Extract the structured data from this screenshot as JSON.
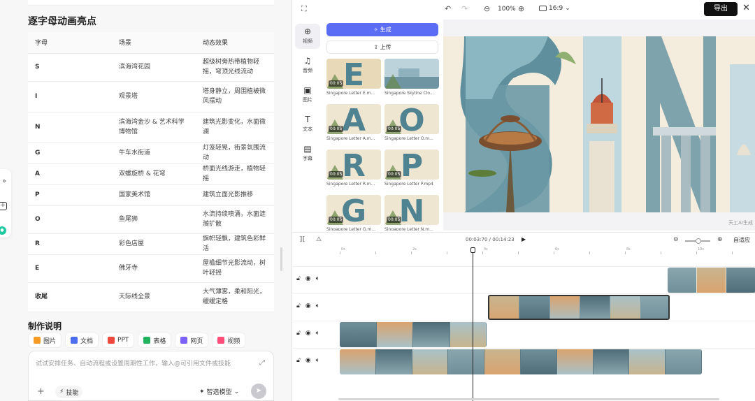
{
  "chat": {
    "section_title": "逐字母动画亮点",
    "table": {
      "headers": [
        "字母",
        "场景",
        "动态效果"
      ],
      "rows": [
        {
          "letter": "S",
          "scene": "滨海湾花园",
          "effect": "超级树旁热带植物轻摇，穹顶光线流动"
        },
        {
          "letter": "I",
          "scene": "观景塔",
          "effect": "塔身静立，周围植被微风摆动"
        },
        {
          "letter": "N",
          "scene": "滨海湾金沙 & 艺术科学博物馆",
          "effect": "建筑光影变化，水面微澜"
        },
        {
          "letter": "G",
          "scene": "牛车水街道",
          "effect": "灯笼轻晃，街景氛围流动"
        },
        {
          "letter": "A",
          "scene": "双螺旋桥 & 花穹",
          "effect": "桥面光线游走，植物轻摇"
        },
        {
          "letter": "P",
          "scene": "国家美术馆",
          "effect": "建筑立面光影推移"
        },
        {
          "letter": "O",
          "scene": "鱼尾狮",
          "effect": "水流持续喷涌，水面涟漪扩散"
        },
        {
          "letter": "R",
          "scene": "彩色店屋",
          "effect": "旗帜轻飘，建筑色彩鲜活"
        },
        {
          "letter": "E",
          "scene": "佛牙寺",
          "effect": "屋檐细节光影流动，树叶轻摇"
        },
        {
          "letter": "收尾",
          "scene": "天际线全景",
          "effect": "大气薄雾，柔和阳光，缓缓定格"
        }
      ]
    },
    "section_title2": "制作说明",
    "chips": [
      {
        "label": "图片",
        "color": "#f59a23"
      },
      {
        "label": "文档",
        "color": "#4e6ef2"
      },
      {
        "label": "PPT",
        "color": "#f0483e"
      },
      {
        "label": "表格",
        "color": "#22b35e"
      },
      {
        "label": "网页",
        "color": "#7b61ff"
      },
      {
        "label": "视频",
        "color": "#ff4d7a"
      }
    ],
    "input": {
      "placeholder": "试试安排任务、自动流程或设置周期性工作，输入@可引用文件或技能",
      "skill_label": "技能",
      "model_label": "智选模型"
    }
  },
  "editor": {
    "zoom": "100%",
    "ratio": "16:9",
    "export_label": "导出",
    "tools": [
      {
        "label": "视频",
        "icon": "video-plus-icon"
      },
      {
        "label": "音频",
        "icon": "music-icon"
      },
      {
        "label": "图片",
        "icon": "image-icon"
      },
      {
        "label": "文本",
        "icon": "text-icon"
      },
      {
        "label": "字幕",
        "icon": "subtitle-icon"
      }
    ],
    "generate_label": "生成",
    "upload_label": "上传",
    "media": [
      {
        "label": "Singapore Letter E.m...",
        "duration": "00:05",
        "letter": "E",
        "bg": "#e8d9b8"
      },
      {
        "label": "Singapore Skyline Clo...",
        "duration": "",
        "letter": "",
        "bg": "#bcd3dc"
      },
      {
        "label": "Singapore Letter A.m...",
        "duration": "00:05",
        "letter": "A",
        "bg": "#efe6d2"
      },
      {
        "label": "Singapore Letter O.m...",
        "duration": "00:05",
        "letter": "O",
        "bg": "#efe6d2"
      },
      {
        "label": "Singapore Letter R.m...",
        "duration": "00:05",
        "letter": "R",
        "bg": "#efe6d2"
      },
      {
        "label": "Singapore Letter P.mp4",
        "duration": "00:05",
        "letter": "P",
        "bg": "#efe6d2"
      },
      {
        "label": "Singapore Letter G.m...",
        "duration": "00:05",
        "letter": "G",
        "bg": "#efe6d2"
      },
      {
        "label": "Singapore Letter N.m...",
        "duration": "00:05",
        "letter": "N",
        "bg": "#efe6d2"
      }
    ],
    "watermark": "天工AI生成",
    "timeline": {
      "current_time": "00:03:70",
      "total_time": "00:14:23",
      "fit_label": "自适应",
      "ruler_labels": [
        "0s",
        "2s",
        "4s",
        "6s",
        "8s",
        "10s"
      ]
    }
  }
}
